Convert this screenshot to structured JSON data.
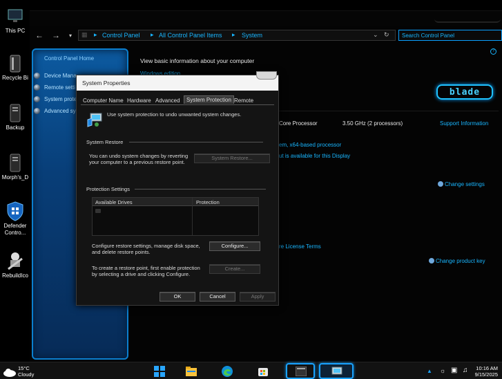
{
  "desktop": {
    "icons": [
      {
        "label": "This PC"
      },
      {
        "label": "Recycle Bi"
      },
      {
        "label": "Backup"
      },
      {
        "label": "Morph's_D"
      },
      {
        "label": "Defender Contro..."
      },
      {
        "label": "RebuildIco"
      }
    ]
  },
  "explorer": {
    "breadcrumb": [
      "Control Panel",
      "All Control Panel Items",
      "System"
    ],
    "search_placeholder": "Search Control Panel",
    "sidebar": {
      "home": "Control Panel Home",
      "items": [
        "Device Mana",
        "Remote setti",
        "System prote",
        "Advanced sy"
      ]
    },
    "main": {
      "heading": "View basic information about your computer",
      "windows_edition": "Windows edition",
      "processor_label": "Core Processor",
      "processor_speed": "3.50 GHz  (2 processors)",
      "support_info": "Support Information",
      "system_type": "em, x64-based processor",
      "pen_touch": "ut is available for this Display",
      "change_settings": "Change settings",
      "license_terms": "re License Terms",
      "change_product_key": "Change product key",
      "logo_text": "blade"
    }
  },
  "dialog": {
    "title": "System Properties",
    "tabs": [
      "Computer Name",
      "Hardware",
      "Advanced",
      "System Protection",
      "Remote"
    ],
    "active_tab": "System Protection",
    "intro": "Use system protection to undo unwanted system changes.",
    "restore_section": "System Restore",
    "restore_text_1": "You can undo system changes by reverting",
    "restore_text_2": "your computer to a previous restore point.",
    "restore_button": "System Restore...",
    "protection_section": "Protection Settings",
    "drives_header": {
      "drive": "Available Drives",
      "protection": "Protection"
    },
    "configure_text_1": "Configure restore settings, manage disk space,",
    "configure_text_2": "and delete restore points.",
    "configure_button": "Configure...",
    "create_text_1": "To create a restore point, first enable protection",
    "create_text_2": "by selecting a drive and clicking Configure.",
    "create_button": "Create...",
    "ok_button": "OK",
    "cancel_button": "Cancel",
    "apply_button": "Apply"
  },
  "taskbar": {
    "weather_temp": "15°C",
    "weather_cond": "Cloudy",
    "time": "10:16 AM",
    "date": "9/15/2025"
  },
  "colors": {
    "accent": "#19b6ff",
    "sidebar": "#0c5aa0"
  }
}
